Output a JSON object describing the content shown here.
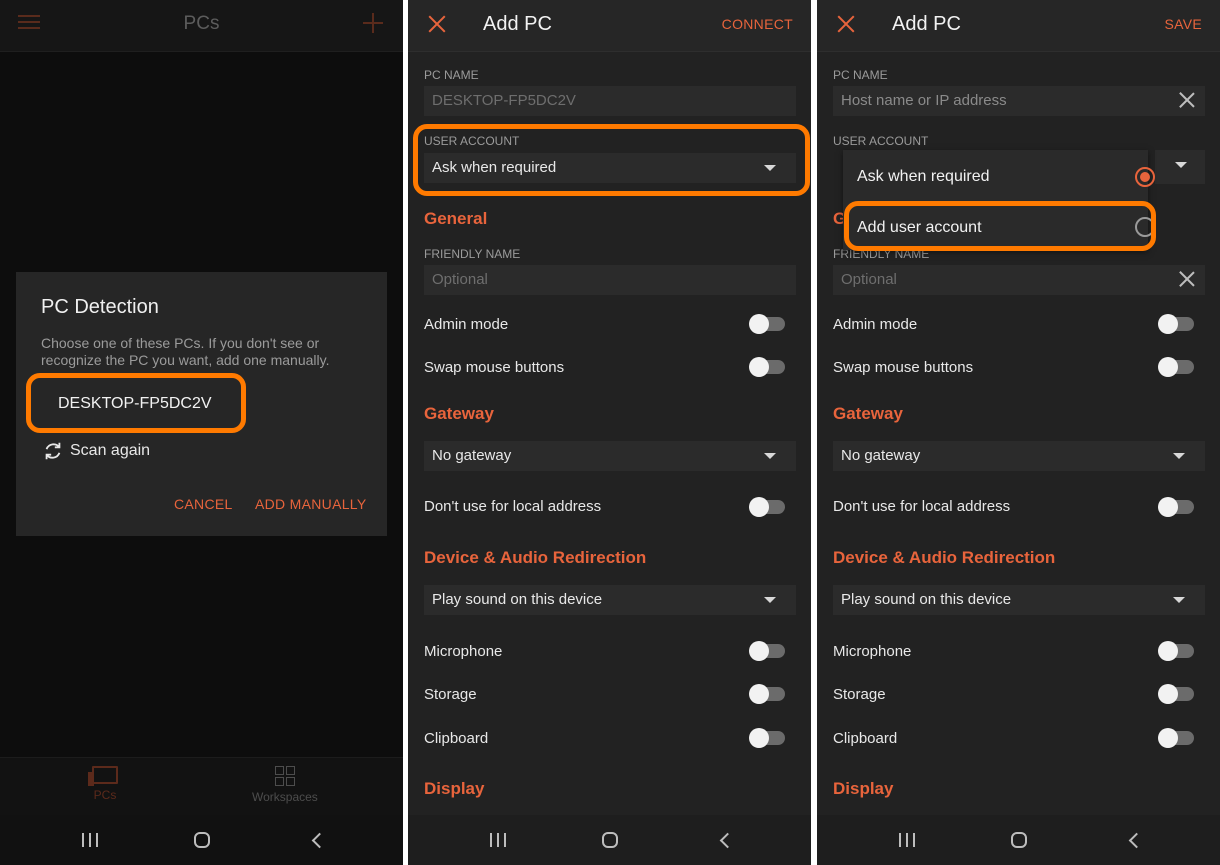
{
  "panel1": {
    "title": "PCs",
    "icons": {
      "menu": "hamburger-icon",
      "add": "plus-icon"
    },
    "dialog": {
      "title": "PC Detection",
      "message": "Choose one of these PCs. If you don't see or recognize the PC you want, add one manually.",
      "pc_item": "DESKTOP-FP5DC2V",
      "scan_label": "Scan again",
      "cancel": "CANCEL",
      "add_manually": "ADD MANUALLY"
    },
    "tabs": [
      {
        "label": "PCs",
        "icon": "monitor-icon"
      },
      {
        "label": "Workspaces",
        "icon": "grid-icon"
      }
    ]
  },
  "panel2": {
    "title": "Add PC",
    "action": "CONNECT",
    "pc_name_label": "PC NAME",
    "pc_name_value": "DESKTOP-FP5DC2V",
    "user_account_label": "USER ACCOUNT",
    "user_account_value": "Ask when required"
  },
  "panel3": {
    "title": "Add PC",
    "action": "SAVE",
    "pc_name_label": "PC NAME",
    "pc_name_placeholder": "Host name or IP address",
    "user_account_label": "USER ACCOUNT",
    "popup_options": [
      "Ask when required",
      "Add user account"
    ],
    "selected_option": "Ask when required",
    "general_peek": "G",
    "friendly_peek": "FRIENDLY NAME"
  },
  "form": {
    "general": "General",
    "friendly_name_label": "FRIENDLY NAME",
    "friendly_name_placeholder": "Optional",
    "admin_mode": "Admin mode",
    "swap_mouse": "Swap mouse buttons",
    "gateway": "Gateway",
    "gateway_value": "No gateway",
    "dont_use_local": "Don't use for local address",
    "device_audio": "Device & Audio Redirection",
    "sound_value": "Play sound on this device",
    "microphone": "Microphone",
    "storage": "Storage",
    "clipboard": "Clipboard",
    "display": "Display"
  },
  "colors": {
    "accent": "#e8643c",
    "highlight": "#ff7a00",
    "background": "#222222"
  }
}
